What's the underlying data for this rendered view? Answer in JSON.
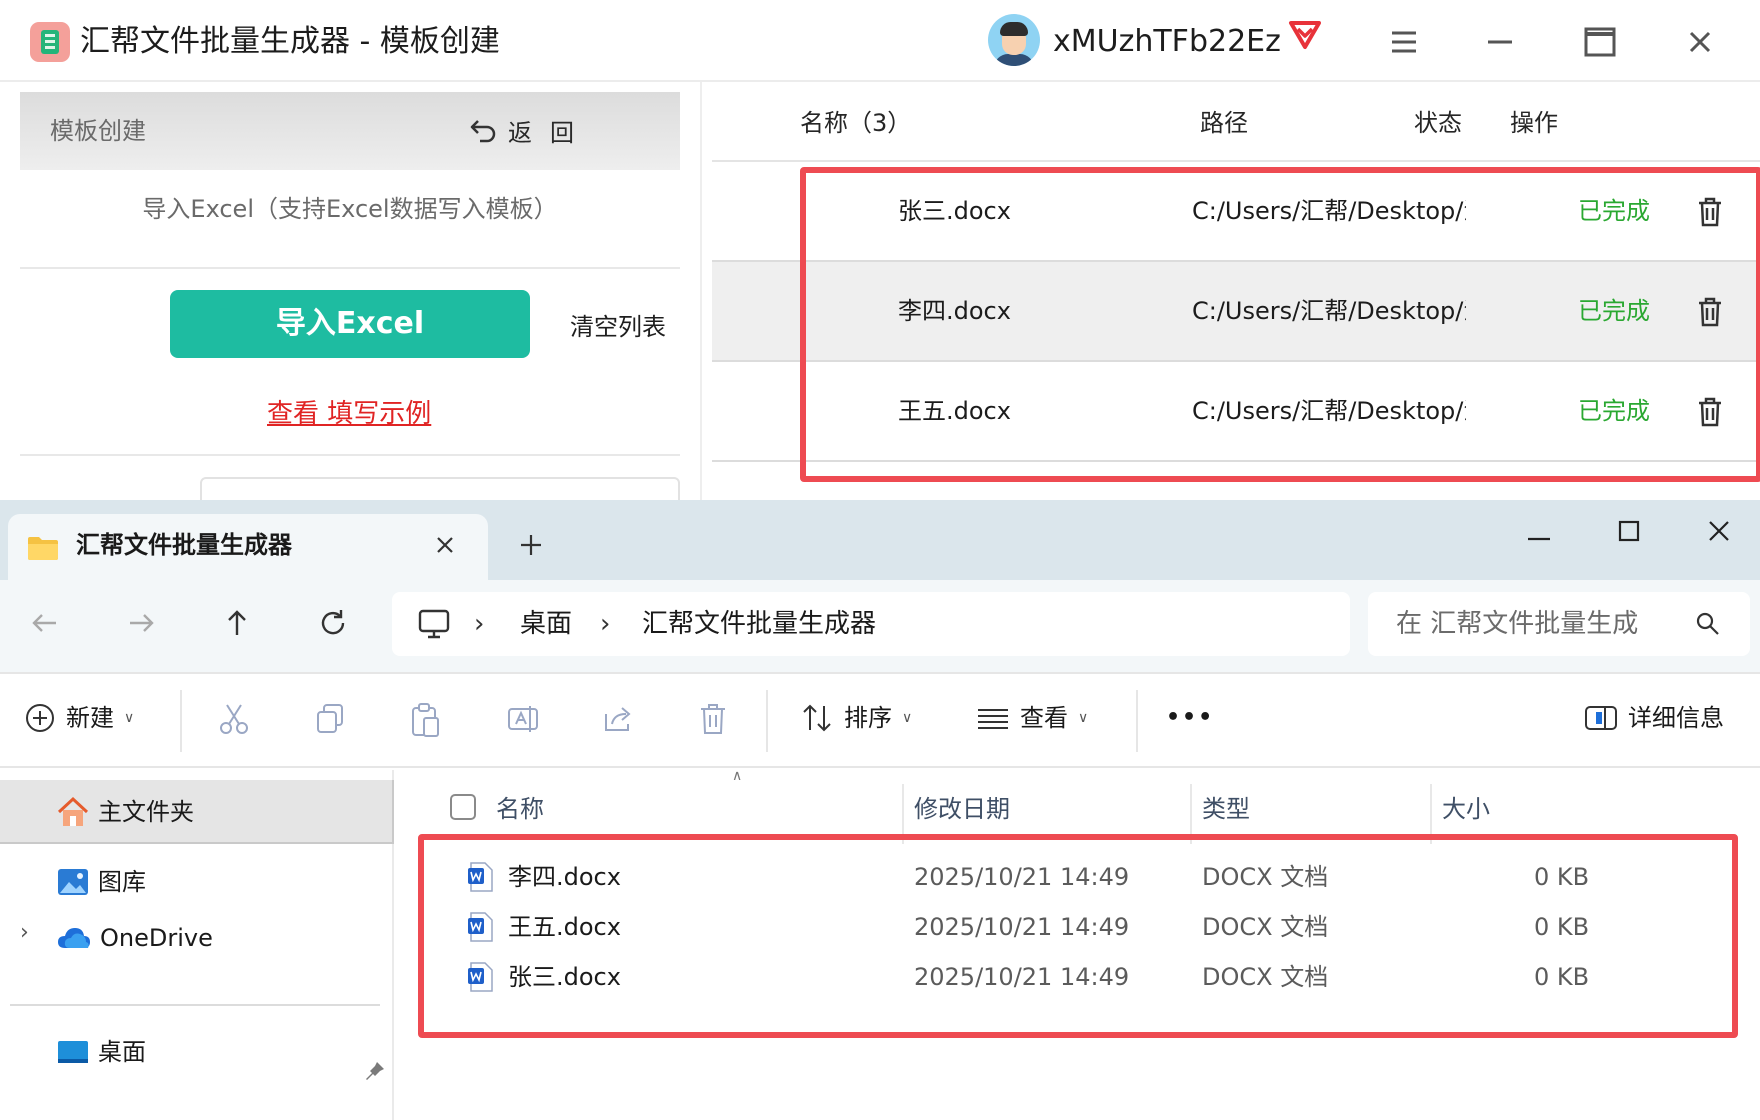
{
  "app": {
    "title": "汇帮文件批量生成器 - 模板创建",
    "username": "xMUzhTFb22Ez",
    "left_panel": {
      "header": "模板创建",
      "back_label": "返回",
      "import_hint": "导入Excel（支持Excel数据写入模板）",
      "import_button": "导入Excel",
      "clear_list": "清空列表",
      "example_link": "查看 填写示例"
    },
    "table": {
      "headers": {
        "name": "名称（3）",
        "path": "路径",
        "status": "状态",
        "action": "操作"
      },
      "rows": [
        {
          "name": "张三.docx",
          "path": "C:/Users/汇帮/Desktop/汇帮文件",
          "status": "已完成"
        },
        {
          "name": "李四.docx",
          "path": "C:/Users/汇帮/Desktop/汇帮文件",
          "status": "已完成"
        },
        {
          "name": "王五.docx",
          "path": "C:/Users/汇帮/Desktop/汇帮文件",
          "status": "已完成"
        }
      ]
    },
    "colors": {
      "accent": "#1ebca1",
      "status_done": "#2aa831",
      "highlight_border": "#ee4b52",
      "link": "#e02424"
    }
  },
  "explorer": {
    "tab_title": "汇帮文件批量生成器",
    "breadcrumb": [
      "桌面",
      "汇帮文件批量生成器"
    ],
    "search_placeholder": "在 汇帮文件批量生成",
    "toolbar": {
      "new": "新建",
      "sort": "排序",
      "view": "查看",
      "more": "•••",
      "details": "详细信息"
    },
    "sidebar": {
      "home": "主文件夹",
      "gallery": "图库",
      "onedrive": "OneDrive",
      "desktop": "桌面"
    },
    "columns": {
      "name": "名称",
      "date": "修改日期",
      "type": "类型",
      "size": "大小"
    },
    "files": [
      {
        "name": "李四.docx",
        "date": "2025/10/21 14:49",
        "type": "DOCX 文档",
        "size": "0 KB"
      },
      {
        "name": "王五.docx",
        "date": "2025/10/21 14:49",
        "type": "DOCX 文档",
        "size": "0 KB"
      },
      {
        "name": "张三.docx",
        "date": "2025/10/21 14:49",
        "type": "DOCX 文档",
        "size": "0 KB"
      }
    ]
  }
}
